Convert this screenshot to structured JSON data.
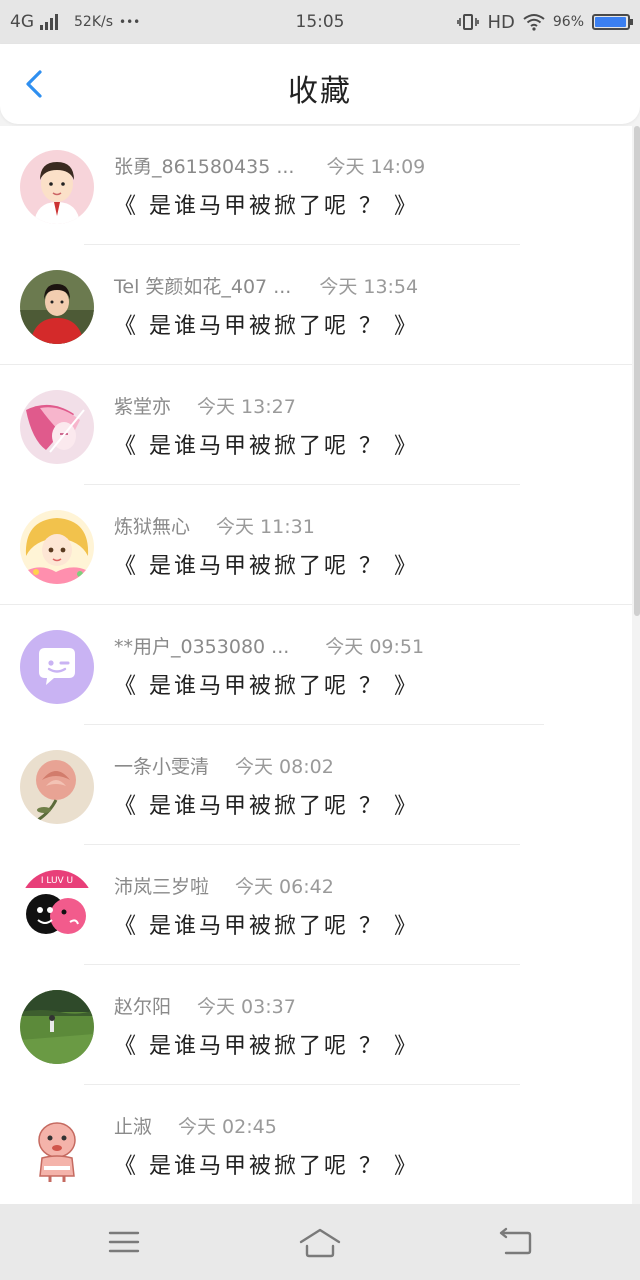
{
  "status_bar": {
    "network": "4G",
    "speed": "52K/s",
    "dots": "•••",
    "time": "15:05",
    "hd": "HD",
    "battery": "96%",
    "battery_level": 0.96
  },
  "header": {
    "title": "收藏",
    "back_icon": "chevron-left-icon"
  },
  "items": [
    {
      "name": "张勇_861580435 ...",
      "time": "今天 14:09",
      "message": "《 是谁马甲被掀了呢 ？ 》",
      "avatar": "avatar-cartoon-boy"
    },
    {
      "name": "Tel 笑颜如花_407 ...",
      "time": "今天 13:54",
      "message": "《 是谁马甲被掀了呢 ？ 》",
      "avatar": "avatar-girl-red"
    },
    {
      "name": "紫堂亦",
      "time": "今天 13:27",
      "message": "《 是谁马甲被掀了呢 ？ 》",
      "avatar": "avatar-anime-pink"
    },
    {
      "name": "炼狱無心",
      "time": "今天 11:31",
      "message": "《 是谁马甲被掀了呢 ？ 》",
      "avatar": "avatar-anime-blonde"
    },
    {
      "name": "**用户_0353080 ...",
      "time": "今天 09:51",
      "message": "《 是谁马甲被掀了呢 ？ 》",
      "avatar": "avatar-default-chat"
    },
    {
      "name": "一条小雯清",
      "time": "今天 08:02",
      "message": "《 是谁马甲被掀了呢 ？ 》",
      "avatar": "avatar-rose"
    },
    {
      "name": "沛岚三岁啦",
      "time": "今天 06:42",
      "message": "《 是谁马甲被掀了呢 ？ 》",
      "avatar": "avatar-i-love-u"
    },
    {
      "name": "赵尔阳",
      "time": "今天 03:37",
      "message": "《 是谁马甲被掀了呢 ？ 》",
      "avatar": "avatar-grass-field"
    },
    {
      "name": "止淑",
      "time": "今天 02:45",
      "message": "《 是谁马甲被掀了呢 ？ 》",
      "avatar": "avatar-baby-cartoon"
    }
  ],
  "nav_bar": {
    "menu_icon": "menu-icon",
    "home_icon": "home-icon",
    "back_icon": "return-icon"
  }
}
